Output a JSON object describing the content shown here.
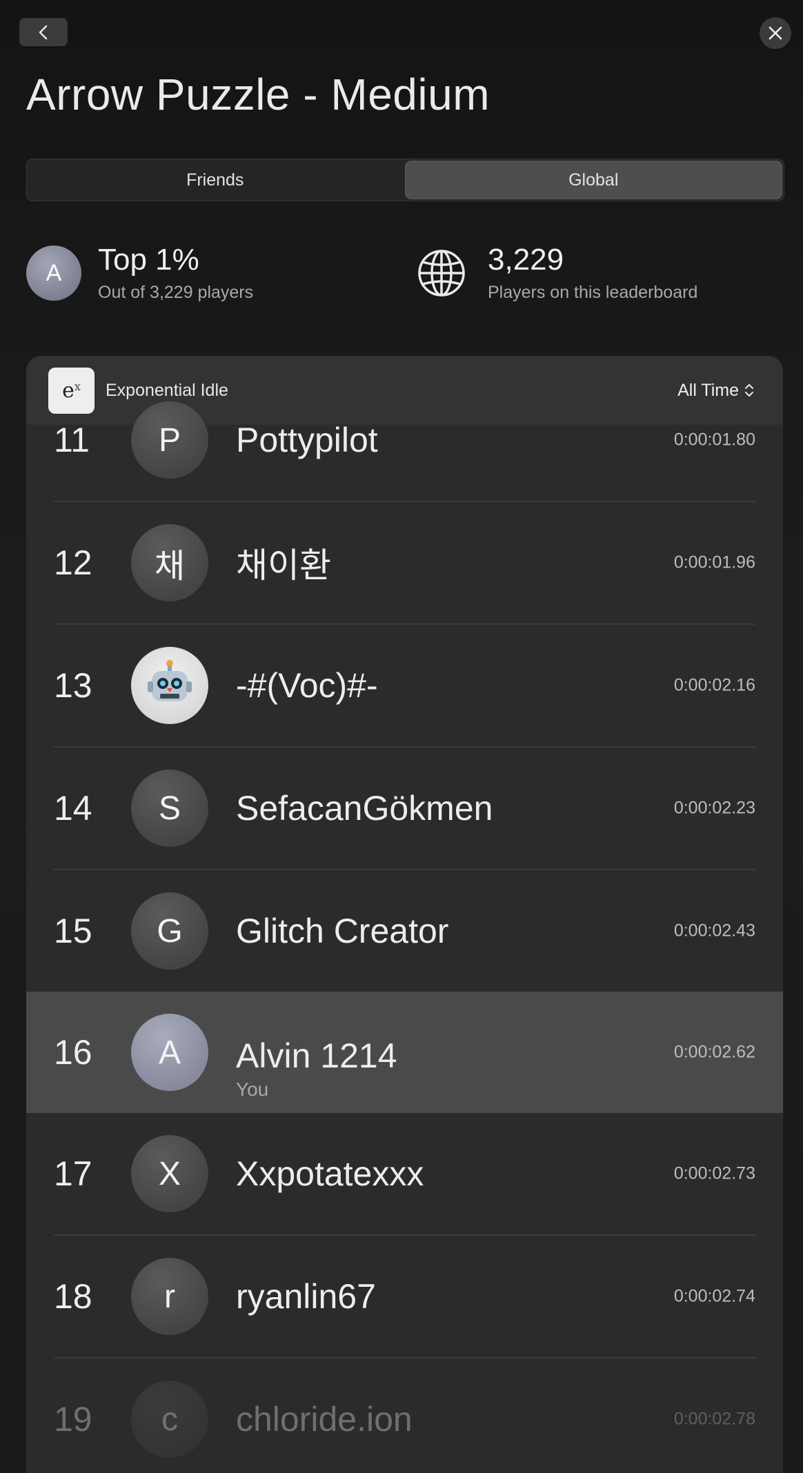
{
  "header": {
    "title": "Arrow Puzzle - Medium"
  },
  "tabs": [
    {
      "label": "Friends",
      "active": false
    },
    {
      "label": "Global",
      "active": true
    }
  ],
  "stats": {
    "rank": {
      "avatar_letter": "A",
      "main": "Top 1%",
      "sub": "Out of 3,229 players"
    },
    "players": {
      "main": "3,229",
      "sub": "Players on this leaderboard"
    }
  },
  "card": {
    "app_name": "Exponential Idle",
    "app_icon_text": "e",
    "app_icon_sup": "x",
    "filter": "All Time"
  },
  "entries": [
    {
      "rank": "11",
      "avatar": "P",
      "name": "Pottypilot",
      "time": "0:00:01.80"
    },
    {
      "rank": "12",
      "avatar": "채",
      "name": "채이환",
      "time": "0:00:01.96"
    },
    {
      "rank": "13",
      "avatar": "",
      "name": "-#(Voc)#-",
      "time": "0:00:02.16"
    },
    {
      "rank": "14",
      "avatar": "S",
      "name": "SefacanGökmen",
      "time": "0:00:02.23"
    },
    {
      "rank": "15",
      "avatar": "G",
      "name": "Glitch Creator",
      "time": "0:00:02.43"
    },
    {
      "rank": "16",
      "avatar": "A",
      "name": "Alvin 1214",
      "sub": "You",
      "time": "0:00:02.62"
    },
    {
      "rank": "17",
      "avatar": "X",
      "name": "Xxpotatexxx",
      "time": "0:00:02.73"
    },
    {
      "rank": "18",
      "avatar": "r",
      "name": "ryanlin67",
      "time": "0:00:02.74"
    },
    {
      "rank": "19",
      "avatar": "c",
      "name": "chloride.ion",
      "time": "0:00:02.78"
    }
  ]
}
